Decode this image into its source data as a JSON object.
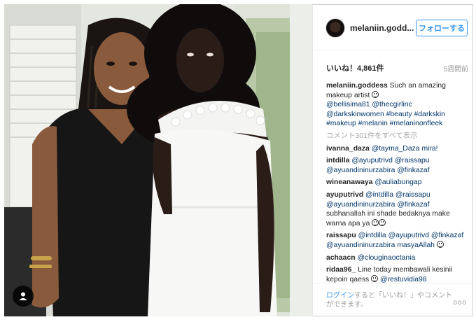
{
  "post": {
    "username": "melaniin.godd...",
    "follow_label": "フォローする",
    "likes_text": "いいね！4,861件",
    "time_ago": "5週間前"
  },
  "caption": {
    "user": "melaniin.goddess",
    "text": "Such an amazing makeup artist",
    "mentions": "@bellisima81 @thecgirlinc",
    "hashtags_line1": "@darkskinwomen #beauty #darkskin",
    "hashtags_line2": "#makeup #melanin #melaninonfleek"
  },
  "view_all_comments": "コメント301件をすべて表示",
  "comments": [
    {
      "user": "ivanna_daza",
      "text": "@tayma_Daza mira!"
    },
    {
      "user": "intdilla",
      "text": "@ayuputrivd @raissapu",
      "text2": "@ayuandininurzabira @finkazaf"
    },
    {
      "user": "wineanawaya",
      "text": "@auliabungap"
    },
    {
      "user": "ayuputrivd",
      "text": "@intdilla @raissapu",
      "text2": "@ayuandininurzabira @finkazaf",
      "text3": "subhanallah ini shade bedaknya make",
      "text4": "warna apa ya"
    },
    {
      "user": "raissapu",
      "text": "@intdilla @ayuputrivd @finkazaf",
      "text2": "@ayuandininurzabira masyaAllah"
    },
    {
      "user": "achaacn",
      "text": "@clouginaoctania"
    },
    {
      "user": "ridaa96_",
      "text": "Line today membawali kesinii",
      "text2": "kepoin qaess",
      "text3": "@restuvidia98"
    }
  ],
  "footer": {
    "login_link": "ログイン",
    "login_text_rest": "すると「いいね！」やコメントができます。",
    "more_label": "ooo"
  },
  "colors": {
    "accent": "#3897f0",
    "username_link": "#003569",
    "muted": "#999999"
  },
  "icons": {
    "tag_button": "person-tag-icon",
    "comment_emoji": "smiley-icon"
  }
}
